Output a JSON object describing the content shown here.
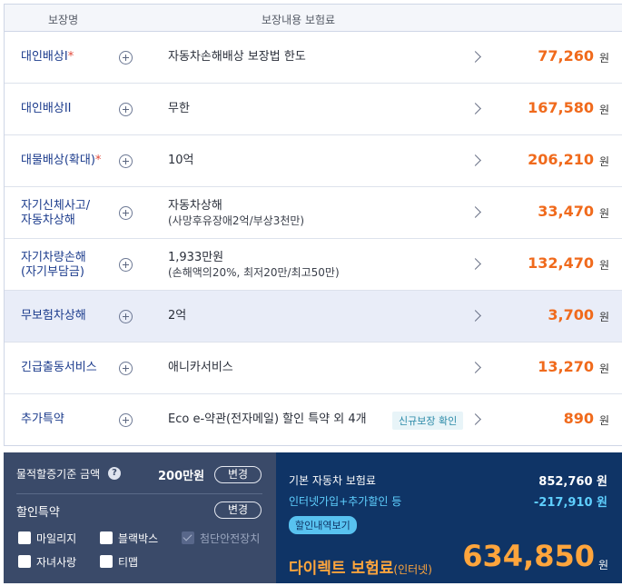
{
  "header": {
    "col_name": "보장명",
    "col_content": "보장내용   보험료"
  },
  "won": "원",
  "rows": [
    {
      "name": "대인배상I",
      "star": "*",
      "content": "자동차손해배상 보장법 한도",
      "price": "77,260"
    },
    {
      "name": "대인배상II",
      "content": "무한",
      "price": "167,580"
    },
    {
      "name": "대물배상(확대)",
      "star": "*",
      "content": "10억",
      "price": "206,210"
    },
    {
      "name_l1": "자기신체사고/",
      "name_l2": "자동차상해",
      "content": "자동차상해",
      "sub": "(사망후유장애2억/부상3천만)",
      "price": "33,470"
    },
    {
      "name_l1": "자기차량손해",
      "name_l2": "(자기부담금)",
      "content": "1,933만원",
      "sub": "(손해액의20%, 최저20만/최고50만)",
      "price": "132,470"
    },
    {
      "name": "무보험차상해",
      "content": "2억",
      "price": "3,700"
    },
    {
      "name": "긴급출동서비스",
      "content": "애니카서비스",
      "price": "13,270"
    },
    {
      "name": "추가특약",
      "content": "Eco e-약관(전자메일) 할인 특약 외 4개",
      "badge": "신규보장 확인",
      "price": "890"
    }
  ],
  "left_panel": {
    "property_label": "물적할증기준 금액",
    "help": "?",
    "property_amount": "200만원",
    "change": "변경",
    "discount_label": "할인특약",
    "options": [
      "마일리지",
      "블랙박스",
      "첨단안전장치",
      "자녀사랑",
      "티맵"
    ]
  },
  "right_panel": {
    "base_label": "기본 자동차 보험료",
    "base_value": "852,760 원",
    "discount_label": "인터넷가입+추가할인 등",
    "discount_value": "-217,910 원",
    "details_button": "할인내역보기",
    "total_label": "다이렉트 보험료",
    "total_suffix": "(인터넷)",
    "total_value": "634,850",
    "won": "원"
  },
  "colors": {
    "accent_orange": "#f06a1c",
    "navy": "#0f3466",
    "panel_gray": "#3a4a69",
    "cyan": "#5fd0ff"
  }
}
